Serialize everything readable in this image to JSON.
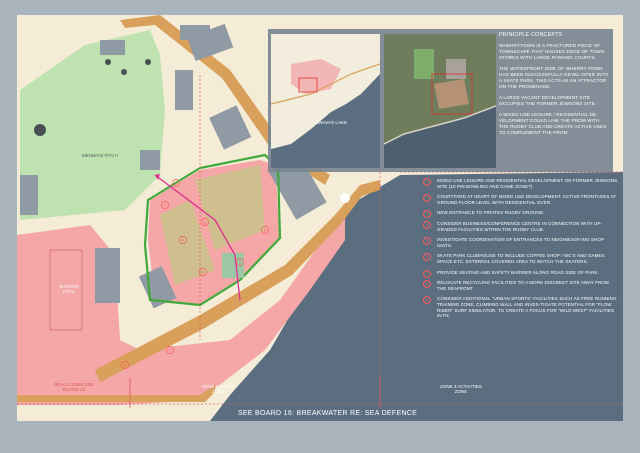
{
  "concept": {
    "title": "PRINCIPLE CONCEPTS",
    "paragraphs": [
      "WHERRYTOWN IS A FRACTURED PIECE OF TOWNSCAPE THAT HOUSES EDGE OF TOWN STORES WITH LARGE PARKING COURTS.",
      "THE WATERFRONT SIDE OF WHERRY-TOWN HAS BEEN SUCCESSFULLY DEVEL-OPED INTO A SKATE PARK. THIS ACTS AS AN ATTRACTOR ON THE PROMENADE.",
      "A LARGE VACANT DEVELOPMENT SITE OCCUPIES THE FORMER JEWSONS SITE.",
      "A MIXED USE LEISURE / RESIDENTIAL DE-VELOPMENT COULD LINK THE PROM WITH THE RUGBY CLUB AND CREATE ACTIVE USES TO COMPLEMENT THE PROM."
    ],
    "lake_label": "GWAVAS LAKE"
  },
  "notes": [
    {
      "num": "1",
      "text": "MIXED-USE LEISURE AND RESIDENTIAL DEVELOPMENT ON FORMER JEWSONS SITE (10 PIN BOWLING AND GAME ZONE?)."
    },
    {
      "num": "2",
      "text": "COURTYARD AT HEART OF MIXED USE DEVELOPMENT. ACTIVE FRONTAGES AT GROUND FLOOR LEVEL WITH RESIDENTIAL OVER."
    },
    {
      "num": "3",
      "text": "NEW ENTRANCE TO PIRATES RUGBY GROUND."
    },
    {
      "num": "4",
      "text": "CONSIDER BUSINESS/CONFERENCE CENTRE IN CONNECTION WITH UP-GRADED FACILITIES WITHIN THE RUGBY CLUB."
    },
    {
      "num": "5",
      "text": "INVESTIGATE COORDINATION OF ENTRANCES TO NEIGHBOUR-ING SHOP UNITS."
    },
    {
      "num": "6",
      "text": "SKATE PARK CLUBHOUSE TO INCLUDE COFFEE SHOP / WC'S AND GAMES SPACE ETC. EXTERNAL COVERED AREA TO WATCH THE SKATERS."
    },
    {
      "num": "7",
      "text": "PROVIDE SEATING AND SAFETY BARRIER ALONG ROAD SIDE OF PARK."
    },
    {
      "num": "8",
      "text": "RELOCATE RECYCLING FACILITIES TO A MORE DISCREET SITE AWAY FROM THE SEAFRONT."
    },
    {
      "num": "9",
      "text": "CONSIDER ADDITIONAL \"URBAN SPORTS\" FACILITIES SUCH AS FREE RUNNING TRAINING ZONE, CLIMBING WALL AND INVES-TIGATE POTENTIAL FOR \"FLOW RIDER\" SURF SIMULATOR. TO CREATE A FOCUS FOR \"WILD WEST\" FACILITIES IN PZ."
    }
  ],
  "map": {
    "pitch_label": "MENNAYE PITCH",
    "pool_label": "BOATING POOL",
    "beach_zone_label": "BEACH ZONE SEE BOARD 13",
    "zone4_label": "ZONE 4 SKATE ZONE",
    "zone3_label": "ZONE 3 ACTIVITIES ZONE",
    "site_markers": [
      "1",
      "2",
      "3",
      "4",
      "5",
      "6",
      "7",
      "8",
      "9"
    ]
  },
  "footer": "SEE BOARD 16: BREAKWATER RE: SEA DEFENCE",
  "colors": {
    "sea": "#5b6e80",
    "land": "#f4ecd7",
    "pink_zone": "#f5a6a6",
    "road": "#d9a05c",
    "green_space": "#bfe3b0",
    "proposal_outline": "#3faa3a",
    "magenta_route": "#e02d8f",
    "note_number": "#ff5a5a"
  }
}
